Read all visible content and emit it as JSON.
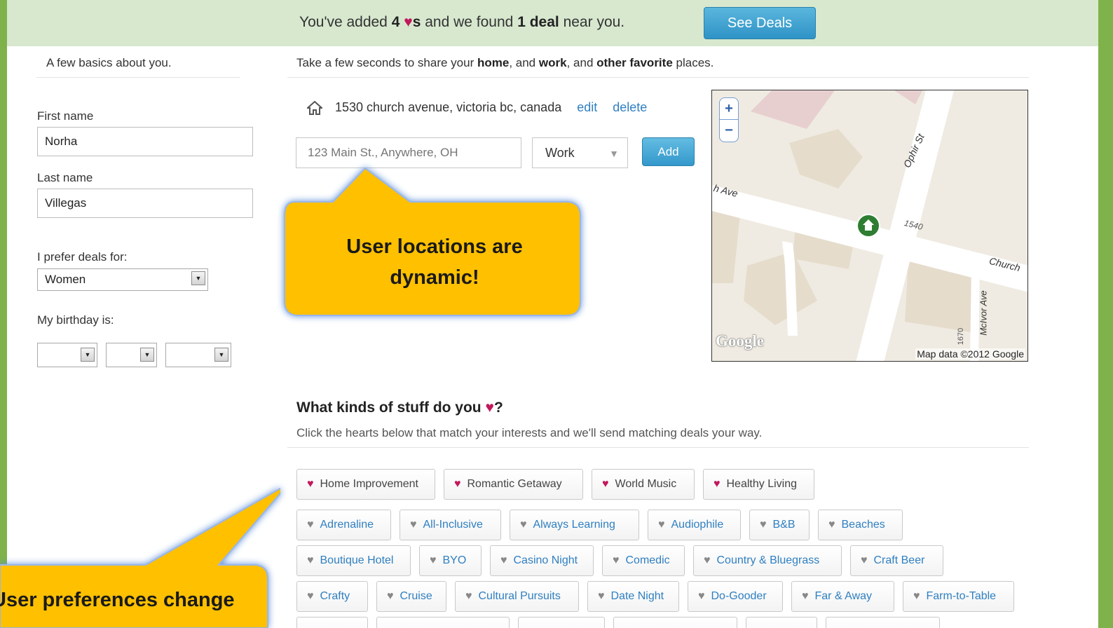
{
  "banner": {
    "text_prefix": "You've added",
    "heart_count": "4",
    "heart_suffix": "s",
    "text_middle": "and we found",
    "deal_count": "1 deal",
    "text_suffix": "near you.",
    "button_label": "See Deals"
  },
  "basics": {
    "heading": "A few basics about you.",
    "first_name_label": "First name",
    "first_name_value": "Norha",
    "last_name_label": "Last name",
    "last_name_value": "Villegas",
    "prefer_label": "I prefer deals for:",
    "prefer_value": "Women",
    "birthday_label": "My birthday is:"
  },
  "places": {
    "heading_prefix": "Take a few seconds to share your",
    "heading_home": "home",
    "heading_work": "work",
    "heading_and": ", and",
    "heading_other": "other favorite",
    "heading_suffix": "places.",
    "saved_address": "1530 church avenue, victoria bc, canada",
    "edit_label": "edit",
    "delete_label": "delete",
    "address_placeholder": "123 Main St., Anywhere, OH",
    "type_value": "Work",
    "add_label": "Add"
  },
  "map": {
    "zoom_in": "+",
    "zoom_out": "−",
    "street_ophir": "Ophir St",
    "street_church_left": "h Ave",
    "street_church_right": "Church",
    "street_mcivor": "McIvor Ave",
    "number_1540": "1540",
    "number_1670": "1670",
    "google_logo": "Google",
    "attribution": "Map data ©2012 Google"
  },
  "callouts": {
    "locations": "User locations are dynamic!",
    "preferences": "User preferences change"
  },
  "interests": {
    "title_prefix": "What kinds of stuff do you",
    "title_suffix": "?",
    "subtitle": "Click the hearts below that match your interests and we'll send matching deals your way.",
    "selected": [
      "Home Improvement",
      "Romantic Getaway",
      "World Music",
      "Healthy Living"
    ],
    "row2": [
      "Adrenaline",
      "All-Inclusive",
      "Always Learning",
      "Audiophile",
      "B&B",
      "Beaches"
    ],
    "row3": [
      "Boutique Hotel",
      "BYO",
      "Casino Night",
      "Comedic",
      "Country & Bluegrass",
      "Craft Beer"
    ],
    "row4": [
      "Crafty",
      "Cruise",
      "Cultural Pursuits",
      "Date Night",
      "Do-Gooder",
      "Far & Away",
      "Farm-to-Table"
    ]
  },
  "colors": {
    "banner_bg": "#d7e8cf",
    "frame_green": "#7fb24a",
    "button_blue": "#3398cb",
    "heart_pink": "#c2185b",
    "link_blue": "#2f7fc1",
    "callout_yellow": "#ffc000"
  }
}
